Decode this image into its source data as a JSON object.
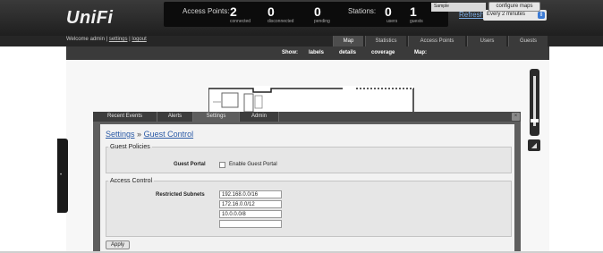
{
  "app": {
    "logo": "UniFi"
  },
  "stats": {
    "access_points_label": "Access Points:",
    "connected_count": "2",
    "connected_label": "connected",
    "disconnected_count": "0",
    "disconnected_label": "disconnected",
    "pending_count": "0",
    "pending_label": "pending",
    "stations_label": "Stations:",
    "users_count": "0",
    "users_label": "users",
    "guests_count": "1",
    "guests_label": "guests"
  },
  "refresh": {
    "label": "Refresh",
    "interval": "Every 2 minutes"
  },
  "welcome": {
    "text": "Welcome admin",
    "settings_link": "settings",
    "logout_link": "logout"
  },
  "nav_tabs": [
    "Map",
    "Statistics",
    "Access Points",
    "Users",
    "Guests"
  ],
  "map_toolbar": {
    "show_label": "Show:",
    "labels": "labels",
    "details": "details",
    "coverage": "coverage",
    "map_label": "Map:",
    "map_select": "Sample",
    "configure_button": "configure maps"
  },
  "panel": {
    "tabs": [
      "Recent Events",
      "Alerts",
      "Settings",
      "Admin"
    ],
    "close": "×",
    "breadcrumb_root": "Settings",
    "breadcrumb_sep": "»",
    "breadcrumb_current": "Guest Control",
    "guest_policies": {
      "legend": "Guest Policies",
      "guest_portal_label": "Guest Portal",
      "enable_label": "Enable Guest Portal"
    },
    "access_control": {
      "legend": "Access Control",
      "restricted_label": "Restricted Subnets",
      "subnets": [
        "192.168.0.0/16",
        "172.16.0.0/12",
        "10.0.0.0/8",
        ""
      ]
    },
    "apply_button": "Apply"
  },
  "colors": {
    "accent": "#2a5aa6",
    "header_bg": "#1f1f1f",
    "panel_bg": "#5e5e5e"
  }
}
